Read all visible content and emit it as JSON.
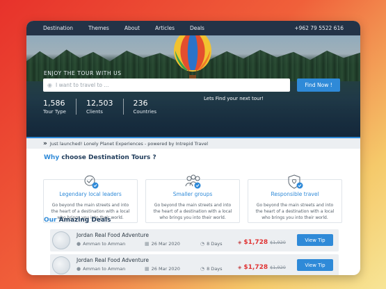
{
  "nav": {
    "items": [
      {
        "label": "Destination"
      },
      {
        "label": "Themes"
      },
      {
        "label": "About"
      },
      {
        "label": "Articles"
      },
      {
        "label": "Deals"
      }
    ],
    "phone": "+962 79 5522 616"
  },
  "hero": {
    "title": "ENJOY THE TOUR WITH US",
    "search_placeholder": "I want to travel to ...",
    "find_button": "Find Now !",
    "tagline": "Lets Find your next tour!",
    "stats": [
      {
        "value": "1,586",
        "label": "Tour Type"
      },
      {
        "value": "12,503",
        "label": "Clients"
      },
      {
        "value": "236",
        "label": "Countries"
      }
    ]
  },
  "ticker": {
    "text": "Just launched! Lonely Planet Experiences - powered by Intrepid Travel"
  },
  "why": {
    "title_accent": "Why",
    "title_rest": "choose Destination Tours ?",
    "cards": [
      {
        "title": "Legendary local leaders",
        "desc": "Go beyond the main streets and into the heart of a destination with a local who brings you into their world.",
        "icon": "leader-badge-icon"
      },
      {
        "title": "Smaller groups",
        "desc": "Go beyond the main streets and into the heart of a destination with a local who brings you into their world.",
        "icon": "group-icon"
      },
      {
        "title": "Responsible travel",
        "desc": "Go beyond the main streets and into the heart of a destination with a local who brings you into their world.",
        "icon": "shield-heart-icon"
      }
    ]
  },
  "deals": {
    "title_accent": "Our",
    "title_rest": "Amazing Deals",
    "rows": [
      {
        "title": "Jordan Real Food Adventure",
        "route": "Amman to Amman",
        "date": "26 Mar 2020",
        "duration": "8 Days",
        "price": "$1,728",
        "old_price": "$1,920",
        "button": "View Tip"
      },
      {
        "title": "Jordan Real Food Adventure",
        "route": "Amman to Amman",
        "date": "26 Mar 2020",
        "duration": "8 Days",
        "price": "$1,728",
        "old_price": "$1,920",
        "button": "View Tip"
      }
    ]
  },
  "colors": {
    "accent": "#2f8ad8",
    "nav_bg": "#233347",
    "price": "#e03434"
  }
}
